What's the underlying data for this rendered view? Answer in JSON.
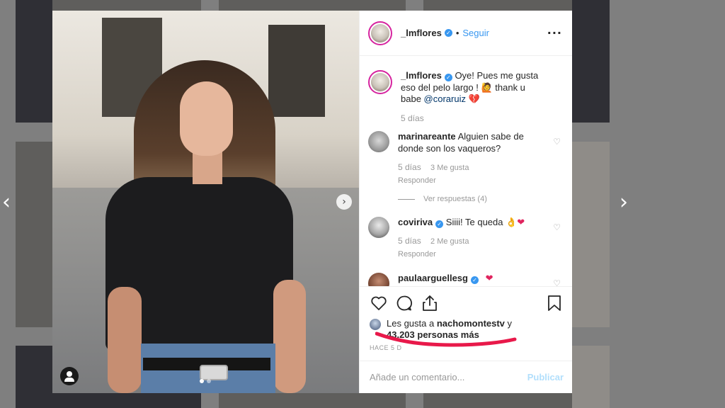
{
  "post": {
    "author": "_lmflores",
    "follow_label": "Seguir",
    "dot": "•",
    "more": "···",
    "next": "›"
  },
  "caption": {
    "author": "_lmflores",
    "text": "Oye! Pues me gusta eso del pelo largo ! 🙋 thank u babe",
    "mention": "@coraruiz",
    "emoji": "💔",
    "time": "5 días"
  },
  "comments": [
    {
      "user": "marinareante",
      "text": "Alguien sabe de donde son los vaqueros?",
      "time": "5 días",
      "likes": "3 Me gusta",
      "reply": "Responder",
      "view_replies": "Ver respuestas (4)"
    },
    {
      "user": "coviriva",
      "text": "Siiii! Te queda 👌",
      "emoji": "❤",
      "time": "5 días",
      "likes": "2 Me gusta",
      "reply": "Responder"
    },
    {
      "user": "paulaarguellesg",
      "emoji": "❤"
    }
  ],
  "likes": {
    "prefix": "Les gusta a",
    "user": "nachomontestv",
    "suffix": "y",
    "count": "43.203 personas más",
    "ago": "HACE 5 D"
  },
  "composer": {
    "placeholder": "Añade un comentario...",
    "publish": "Publicar"
  },
  "nav": {
    "prev": "‹",
    "next": "›"
  },
  "colors": {
    "link": "#3897f0",
    "highlight": "#e8194a",
    "verified": "#3897f0"
  }
}
